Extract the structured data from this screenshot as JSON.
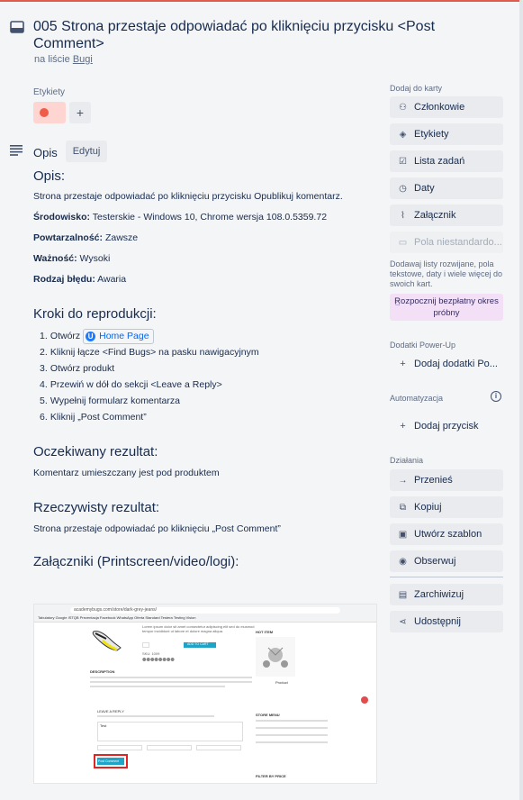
{
  "card": {
    "title": "005 Strona przestaje odpowiadać po kliknięciu przycisku <Post Comment>",
    "list_prefix": "na liście",
    "list_name": "Bugi"
  },
  "labels": {
    "heading": "Etykiety",
    "add_symbol": "+",
    "chip_color": "#ffd5d2",
    "dot_color": "#ef5c48"
  },
  "description": {
    "section_label": "Opis",
    "edit_label": "Edytuj",
    "heading": "Opis:",
    "summary": "Strona przestaje odpowiadać po kliknięciu przycisku Opublikuj komentarz.",
    "fields": [
      {
        "key": "Środowisko:",
        "value": " Testerskie - Windows 10, Chrome wersja 108.0.5359.72"
      },
      {
        "key": "Powtarzalność:",
        "value": " Zawsze"
      },
      {
        "key": "Ważność:",
        "value": " Wysoki"
      },
      {
        "key": "Rodzaj błędu:",
        "value": " Awaria"
      }
    ],
    "steps_heading": "Kroki do reprodukcji:",
    "steps": [
      {
        "num": "1.",
        "text": "Otwórz",
        "chip": "Home Page"
      },
      {
        "num": "2.",
        "text": "Kliknij łącze <Find Bugs> na pasku nawigacyjnym"
      },
      {
        "num": "3.",
        "text": "Otwórz produkt"
      },
      {
        "num": "4.",
        "text": "Przewiń w dół do sekcji <Leave a Reply>"
      },
      {
        "num": "5.",
        "text": "Wypełnij formularz komentarza"
      },
      {
        "num": "6.",
        "text": "Kliknij „Post Comment”"
      }
    ],
    "expected_heading": "Oczekiwany rezultat:",
    "expected_text": "Komentarz umieszczany jest pod produktem",
    "actual_heading": "Rzeczywisty rezultat:",
    "actual_text": "Strona przestaje odpowiadać po kliknięciu „Post Comment”",
    "attachments_heading": "Załączniki (Printscreen/video/logi):"
  },
  "screenshot": {
    "url": "academybugs.com/store/dark-grey-jeans/",
    "bookmarks": "Tabulatory Google   ISTQB   Prezentacja   Facebook   WhatsApp   Ofertа   Standard Testerа   Testing Vision",
    "side_heading": "HOT ITEM",
    "store_menu": "STORE MENU",
    "filter": "FILTER BY PRICE",
    "leave_reply": "LEAVE A REPLY",
    "description_tab": "DESCRIPTION",
    "comment_sample": "Test",
    "add_to_cart": "ADD TO CART",
    "post_comment": "Post Comment"
  },
  "sidebar": {
    "add_to_card_heading": "Dodaj do karty",
    "buttons": [
      {
        "icon": "person-icon",
        "glyph": "⚇",
        "label": "Członkowie"
      },
      {
        "icon": "tag-icon",
        "glyph": "◈",
        "label": "Etykiety"
      },
      {
        "icon": "checklist-icon",
        "glyph": "☑",
        "label": "Lista zadań"
      },
      {
        "icon": "clock-icon",
        "glyph": "◷",
        "label": "Daty"
      },
      {
        "icon": "paperclip-icon",
        "glyph": "⌇",
        "label": "Załącznik"
      }
    ],
    "custom_fields_label": "Pola niestandardo...",
    "custom_fields_note": "Dodawaj listy rozwijane, pola tekstowe, daty i wiele więcej do swoich kart.",
    "trial_label": "Rozpocznij bezpłatny okres próbny",
    "powerups_heading": "Dodatki Power-Up",
    "add_powerups_label": "Dodaj dodatki Po...",
    "automation_heading": "Automatyzacja",
    "add_button_label": "Dodaj przycisk",
    "actions_heading": "Działania",
    "actions": [
      {
        "icon": "arrow-right-icon",
        "glyph": "→",
        "label": "Przenieś"
      },
      {
        "icon": "copy-icon",
        "glyph": "⧉",
        "label": "Kopiuj"
      },
      {
        "icon": "template-icon",
        "glyph": "▣",
        "label": "Utwórz szablon"
      },
      {
        "icon": "eye-icon",
        "glyph": "◉",
        "label": "Obserwuj"
      }
    ],
    "archive_label": "Zarchiwizuj",
    "share_label": "Udostępnij"
  }
}
